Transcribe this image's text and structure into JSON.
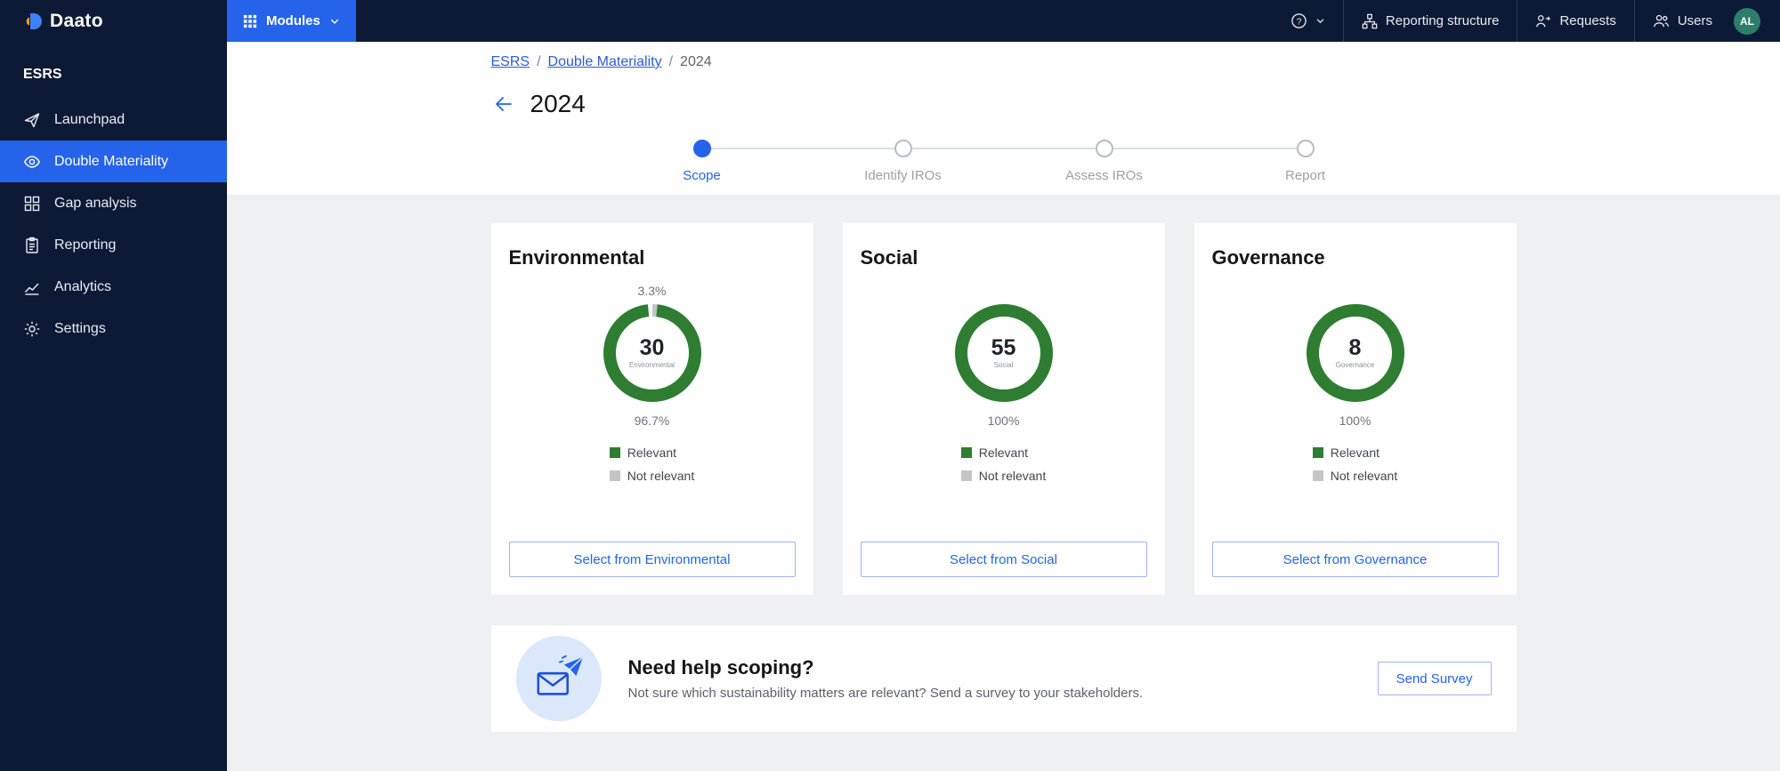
{
  "topbar": {
    "logo_text": "Daato",
    "modules_label": "Modules",
    "nav_items": [
      {
        "label": "Reporting structure"
      },
      {
        "label": "Requests"
      },
      {
        "label": "Users"
      }
    ],
    "avatar_initials": "AL"
  },
  "sidebar": {
    "section_title": "ESRS",
    "items": [
      {
        "label": "Launchpad"
      },
      {
        "label": "Double Materiality"
      },
      {
        "label": "Gap analysis"
      },
      {
        "label": "Reporting"
      },
      {
        "label": "Analytics"
      },
      {
        "label": "Settings"
      }
    ]
  },
  "breadcrumb": {
    "separator": "/",
    "items": [
      {
        "label": "ESRS"
      },
      {
        "label": "Double Materiality"
      },
      {
        "label": "2024"
      }
    ]
  },
  "page": {
    "title": "2024"
  },
  "stepper": {
    "steps": [
      {
        "label": "Scope"
      },
      {
        "label": "Identify IROs"
      },
      {
        "label": "Assess IROs"
      },
      {
        "label": "Report"
      }
    ]
  },
  "legend": {
    "relevant": "Relevant",
    "not_relevant": "Not relevant"
  },
  "cards": [
    {
      "title": "Environmental",
      "count": "30",
      "center_label": "Environmental",
      "top_label": "3.3%",
      "bottom_label": "96.7%",
      "relevant_pct": 96.7,
      "not_relevant_pct": 3.3,
      "button": "Select from Environmental"
    },
    {
      "title": "Social",
      "count": "55",
      "center_label": "Social",
      "top_label": "",
      "bottom_label": "100%",
      "relevant_pct": 100,
      "not_relevant_pct": 0,
      "button": "Select from Social"
    },
    {
      "title": "Governance",
      "count": "8",
      "center_label": "Governance",
      "top_label": "",
      "bottom_label": "100%",
      "relevant_pct": 100,
      "not_relevant_pct": 0,
      "button": "Select from Governance"
    }
  ],
  "help_card": {
    "title": "Need help scoping?",
    "subtitle": "Not sure which sustainability matters are relevant? Send a survey to your stakeholders.",
    "button": "Send Survey"
  },
  "colors": {
    "accent": "#2563eb",
    "link": "#2e5bd7",
    "relevant": "#2e7d32",
    "not_relevant": "#c3c5c7",
    "avatar": "#2e7d6b"
  }
}
